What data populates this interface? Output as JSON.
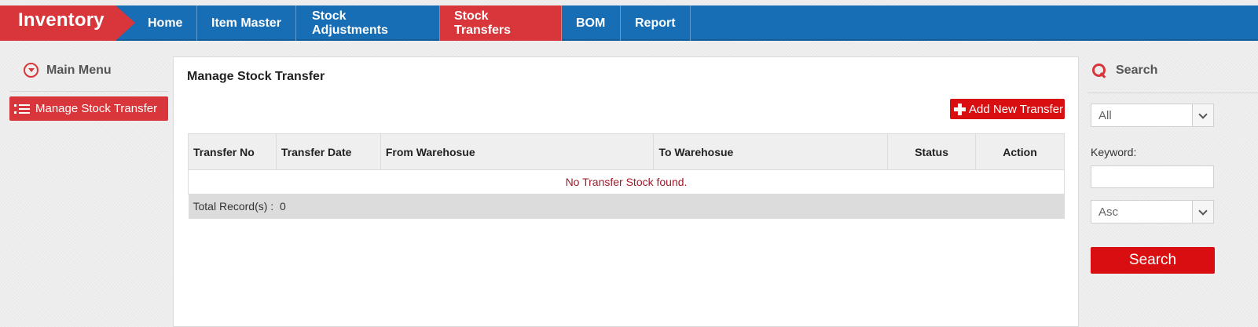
{
  "app": {
    "brand": "Inventory"
  },
  "nav": {
    "items": [
      {
        "label": "Home"
      },
      {
        "label": "Item Master"
      },
      {
        "label": "Stock Adjustments"
      },
      {
        "label": "Stock Transfers",
        "active": true
      },
      {
        "label": "BOM"
      },
      {
        "label": "Report"
      }
    ]
  },
  "sidebar": {
    "heading": "Main Menu",
    "items": [
      {
        "label": "Manage Stock Transfer"
      }
    ]
  },
  "main": {
    "title": "Manage Stock Transfer",
    "add_button": "Add New Transfer",
    "table": {
      "columns": [
        "Transfer No",
        "Transfer Date",
        "From Warehosue",
        "To Warehosue",
        "Status",
        "Action"
      ],
      "empty_message": "No Transfer Stock found.",
      "total_label": "Total Record(s) :",
      "total_value": "0"
    }
  },
  "search": {
    "heading": "Search",
    "filter_select": "All",
    "keyword_label": "Keyword:",
    "keyword_value": "",
    "sort_select": "Asc",
    "button": "Search"
  },
  "colors": {
    "nav_blue": "#176eb4",
    "accent_red": "#d8363a",
    "button_red": "#d80e10"
  }
}
